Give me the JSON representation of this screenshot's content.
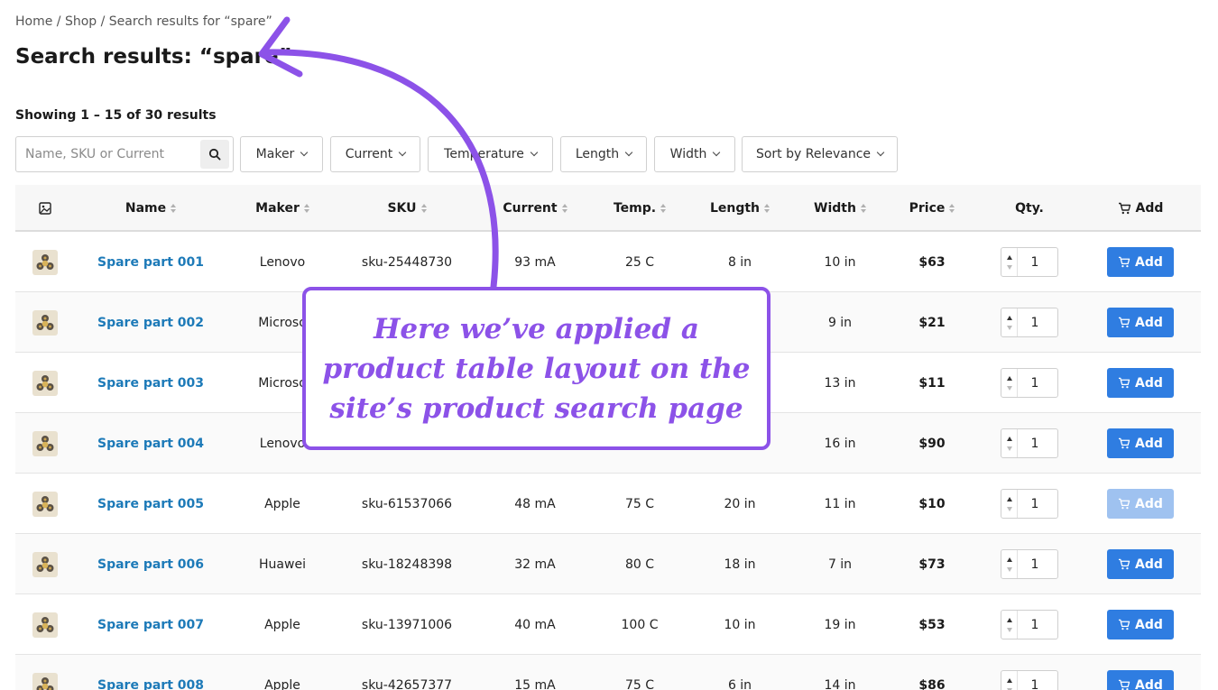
{
  "breadcrumb": "Home / Shop / Search results for “spare”",
  "page_title": "Search results: “spare”",
  "showing_text": "Showing 1 – 15 of 30 results",
  "search": {
    "placeholder": "Name, SKU or Current",
    "value": ""
  },
  "filters": {
    "maker": "Maker",
    "current": "Current",
    "temperature": "Temperature",
    "length": "Length",
    "width": "Width",
    "sort": "Sort by Relevance"
  },
  "table": {
    "headers": {
      "name": "Name",
      "maker": "Maker",
      "sku": "SKU",
      "current": "Current",
      "temp": "Temp.",
      "length": "Length",
      "width": "Width",
      "price": "Price",
      "qty": "Qty.",
      "add": "Add"
    },
    "add_label": "Add",
    "rows": [
      {
        "name": "Spare part 001",
        "maker": "Lenovo",
        "sku": "sku-25448730",
        "current": "93 mA",
        "temp": "25 C",
        "length": "8 in",
        "width": "10 in",
        "price": "$63",
        "qty": "1",
        "add_disabled": false
      },
      {
        "name": "Spare part 002",
        "maker": "Microso",
        "sku": "",
        "current": "",
        "temp": "",
        "length": "",
        "width": "9 in",
        "price": "$21",
        "qty": "1",
        "add_disabled": false
      },
      {
        "name": "Spare part 003",
        "maker": "Microso",
        "sku": "",
        "current": "",
        "temp": "",
        "length": "",
        "width": "13 in",
        "price": "$11",
        "qty": "1",
        "add_disabled": false
      },
      {
        "name": "Spare part 004",
        "maker": "Lenovo",
        "sku": "",
        "current": "",
        "temp": "",
        "length": "",
        "width": "16 in",
        "price": "$90",
        "qty": "1",
        "add_disabled": false
      },
      {
        "name": "Spare part 005",
        "maker": "Apple",
        "sku": "sku-61537066",
        "current": "48 mA",
        "temp": "75 C",
        "length": "20 in",
        "width": "11 in",
        "price": "$10",
        "qty": "1",
        "add_disabled": true
      },
      {
        "name": "Spare part 006",
        "maker": "Huawei",
        "sku": "sku-18248398",
        "current": "32 mA",
        "temp": "80 C",
        "length": "18 in",
        "width": "7 in",
        "price": "$73",
        "qty": "1",
        "add_disabled": false
      },
      {
        "name": "Spare part 007",
        "maker": "Apple",
        "sku": "sku-13971006",
        "current": "40 mA",
        "temp": "100 C",
        "length": "10 in",
        "width": "19 in",
        "price": "$53",
        "qty": "1",
        "add_disabled": false
      },
      {
        "name": "Spare part 008",
        "maker": "Apple",
        "sku": "sku-42657377",
        "current": "15 mA",
        "temp": "75 C",
        "length": "6 in",
        "width": "14 in",
        "price": "$86",
        "qty": "1",
        "add_disabled": false
      }
    ]
  },
  "annotation": {
    "text": "Here we’ve applied a product table layout on the site’s product search page",
    "color": "#8c52e8"
  },
  "colors": {
    "link": "#1d7ab8",
    "add_button": "#2f7de1",
    "add_button_disabled": "#9fc2f0"
  }
}
